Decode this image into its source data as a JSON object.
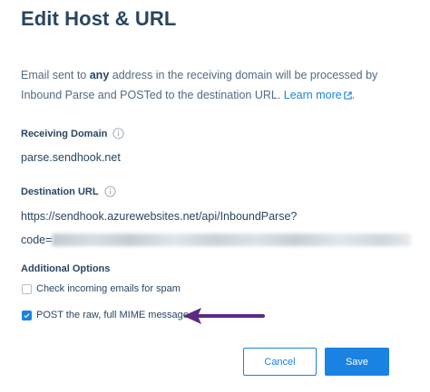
{
  "dialog": {
    "title": "Edit Host & URL",
    "intro": {
      "part1": "Email sent to ",
      "bold": "any",
      "part2": " address in the receiving domain will be processed by Inbound Parse and POSTed to the destination URL. ",
      "link": "Learn more",
      "part3": "."
    }
  },
  "receiving_domain": {
    "label": "Receiving Domain",
    "value": "parse.sendhook.net"
  },
  "destination_url": {
    "label": "Destination URL",
    "value_line1": "https://sendhook.azurewebsites.net/api/InboundParse?",
    "value_line2_prefix": "code="
  },
  "additional_options": {
    "label": "Additional Options",
    "options": [
      {
        "label": "Check incoming emails for spam",
        "checked": false
      },
      {
        "label": "POST the raw, full MIME message",
        "checked": true
      }
    ]
  },
  "buttons": {
    "cancel": "Cancel",
    "save": "Save"
  },
  "colors": {
    "heading": "#294661",
    "body_text": "#546b81",
    "accent": "#1a82e2",
    "annotation_arrow": "#5b2a86"
  },
  "icons": [
    "external-link-icon",
    "info-icon",
    "checkmark-icon",
    "arrow-annotation"
  ]
}
